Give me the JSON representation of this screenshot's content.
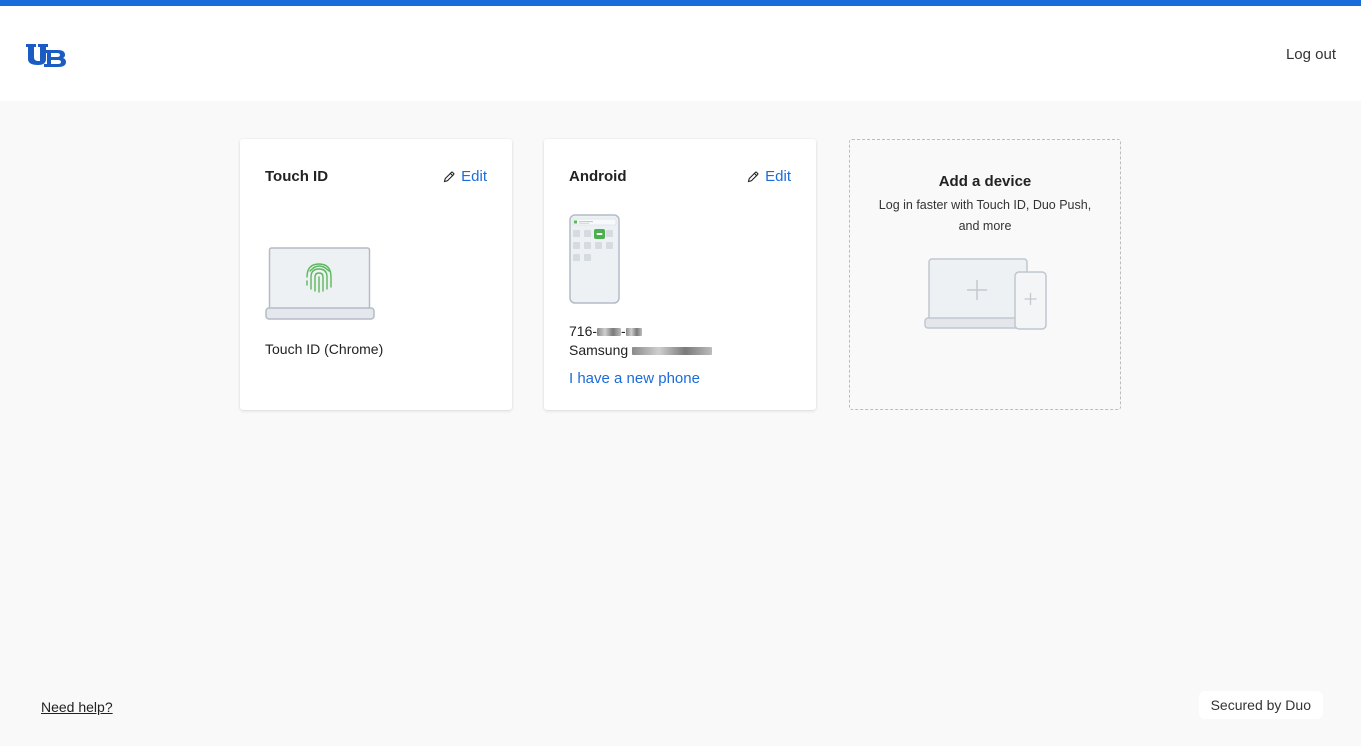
{
  "header": {
    "logo_alt": "UB",
    "logout_label": "Log out"
  },
  "colors": {
    "accent": "#1a6cdb",
    "fingerprint": "#5cb85c",
    "duo_green": "#4caf50"
  },
  "devices": [
    {
      "title": "Touch ID",
      "edit_label": "Edit",
      "name": "Touch ID (Chrome)",
      "icon": "laptop-fingerprint-icon"
    },
    {
      "title": "Android",
      "edit_label": "Edit",
      "phone_prefix": "716-",
      "phone_sep": "-",
      "model_prefix": "Samsung ",
      "new_phone_link": "I have a new phone",
      "icon": "android-phone-icon"
    }
  ],
  "add_device": {
    "title": "Add a device",
    "subtitle": "Log in faster with Touch ID, Duo Push, and more",
    "icon": "add-device-icon"
  },
  "footer": {
    "help_label": "Need help?",
    "secured_label": "Secured by Duo"
  }
}
